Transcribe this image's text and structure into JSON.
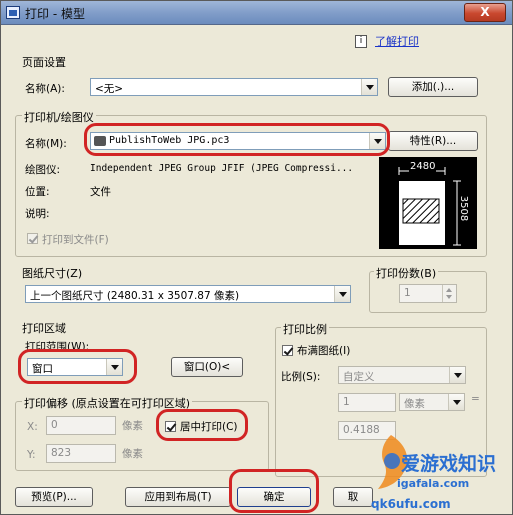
{
  "window": {
    "title": "打印 - 模型",
    "close_label": "X",
    "help_link": "了解打印",
    "help_icon_label": "i"
  },
  "page_setup": {
    "title": "页面设置",
    "name_label": "名称(A):",
    "name_value": "<无>",
    "add_button": "添加(.)..."
  },
  "printer": {
    "title": "打印机/绘图仪",
    "name_label": "名称(M):",
    "name_value": "PublishToWeb JPG.pc3",
    "properties_button": "特性(R)...",
    "plotter_label": "绘图仪:",
    "plotter_value": "Independent JPEG Group JFIF (JPEG Compressi...",
    "location_label": "位置:",
    "location_value": "文件",
    "description_label": "说明:",
    "plot_to_file_label": "打印到文件(F)",
    "plot_to_file_checked": true
  },
  "preview": {
    "width_label": "2480",
    "height_label": "3508"
  },
  "paper_size": {
    "title": "图纸尺寸(Z)",
    "value": "上一个图纸尺寸   (2480.31 x 3507.87 像素)"
  },
  "copies": {
    "title": "打印份数(B)",
    "value": "1"
  },
  "plot_area": {
    "title": "打印区域",
    "what_to_plot_label": "打印范围(W):",
    "what_to_plot_value": "窗口",
    "window_button": "窗口(O)<"
  },
  "plot_offset": {
    "title": "打印偏移 (原点设置在可打印区域)",
    "x_label": "X:",
    "x_value": "0",
    "y_label": "Y:",
    "y_value": "823",
    "x_unit": "像素",
    "y_unit": "像素",
    "center_label": "居中打印(C)",
    "center_checked": true
  },
  "plot_scale": {
    "title": "打印比例",
    "fit_label": "布满图纸(I)",
    "fit_checked": true,
    "scale_label": "比例(S):",
    "scale_value": "自定义",
    "value1": "1",
    "unit_value": "像素",
    "value2": "0.4188",
    "equals": "="
  },
  "buttons": {
    "preview": "预览(P)...",
    "apply_layout": "应用到布局(T)",
    "ok": "确定",
    "cancel": "取"
  },
  "watermark": {
    "text1": "爱游戏知识",
    "text2": "qk6ufu.com",
    "text3": "igafala.com"
  }
}
